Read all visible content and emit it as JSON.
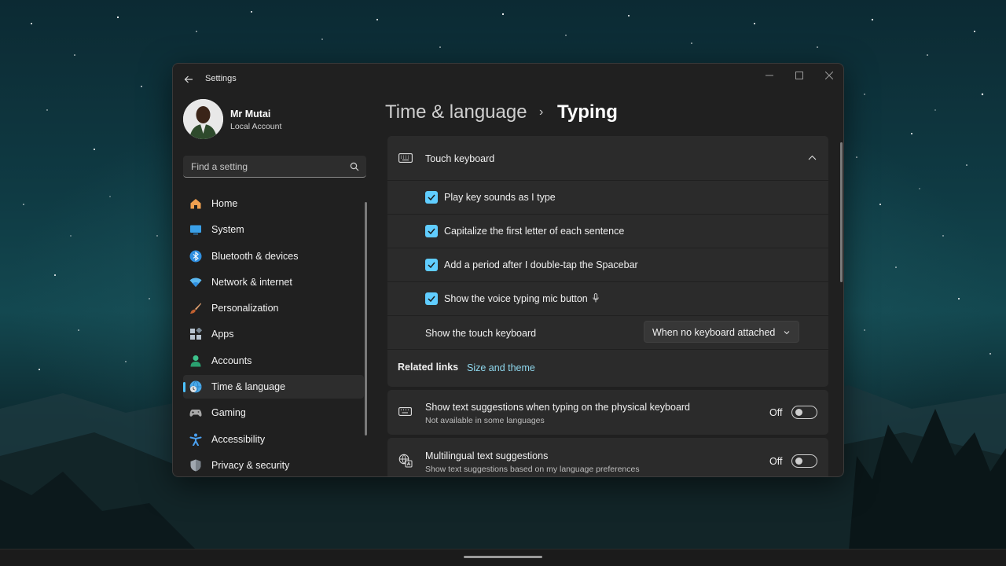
{
  "window": {
    "app_title": "Settings"
  },
  "user": {
    "name": "Mr Mutai",
    "account_type": "Local Account"
  },
  "search": {
    "placeholder": "Find a setting"
  },
  "sidebar": {
    "items": [
      {
        "label": "Home",
        "icon": "home-icon",
        "color": "#f0a050"
      },
      {
        "label": "System",
        "icon": "system-icon",
        "color": "#3aa0e8"
      },
      {
        "label": "Bluetooth & devices",
        "icon": "bluetooth-icon",
        "color": "#2f8fe0"
      },
      {
        "label": "Network & internet",
        "icon": "wifi-icon",
        "color": "#5bb8f0"
      },
      {
        "label": "Personalization",
        "icon": "brush-icon",
        "color": "#e0a070"
      },
      {
        "label": "Apps",
        "icon": "apps-icon",
        "color": "#b8c4d0"
      },
      {
        "label": "Accounts",
        "icon": "accounts-icon",
        "color": "#3dc38c"
      },
      {
        "label": "Time & language",
        "icon": "globe-clock-icon",
        "color": "#48a8e8",
        "active": true
      },
      {
        "label": "Gaming",
        "icon": "gamepad-icon",
        "color": "#a8a8a8"
      },
      {
        "label": "Accessibility",
        "icon": "accessibility-icon",
        "color": "#4aa0f0"
      },
      {
        "label": "Privacy & security",
        "icon": "shield-icon",
        "color": "#a0a8b0"
      }
    ]
  },
  "breadcrumb": {
    "parent": "Time & language",
    "separator": "›",
    "current": "Typing"
  },
  "touch_keyboard": {
    "title": "Touch keyboard",
    "expanded": true,
    "options": [
      {
        "label": "Play key sounds as I type",
        "checked": true
      },
      {
        "label": "Capitalize the first letter of each sentence",
        "checked": true
      },
      {
        "label": "Add a period after I double-tap the Spacebar",
        "checked": true
      },
      {
        "label": "Show the voice typing mic button",
        "checked": true
      }
    ],
    "show_keyboard": {
      "label": "Show the touch keyboard",
      "value": "When no keyboard attached"
    },
    "related": {
      "label": "Related links",
      "link": "Size and theme"
    }
  },
  "text_suggestions": {
    "title": "Show text suggestions when typing on the physical keyboard",
    "subtitle": "Not available in some languages",
    "state": "Off"
  },
  "multilingual": {
    "title": "Multilingual text suggestions",
    "subtitle": "Show text suggestions based on my language preferences",
    "state": "Off"
  },
  "colors": {
    "accent": "#60cdff",
    "link": "#8fd8ee",
    "window_bg": "#202020",
    "card_bg": "#2b2b2b"
  }
}
